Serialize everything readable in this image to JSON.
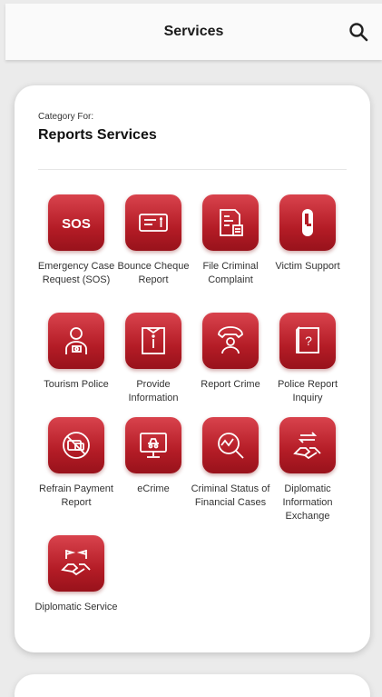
{
  "appbar": {
    "title": "Services",
    "search_icon": "search-icon"
  },
  "card": {
    "category_label": "Category For:",
    "category_title": "Reports Services"
  },
  "services": [
    {
      "label": "Emergency Case Request (SOS)",
      "icon": "sos-icon",
      "icon_text": "SOS"
    },
    {
      "label": "Bounce Cheque Report",
      "icon": "cheque-icon"
    },
    {
      "label": "File Criminal Complaint",
      "icon": "complaint-document-icon"
    },
    {
      "label": "Victim Support",
      "icon": "victim-support-icon"
    },
    {
      "label": "Tourism Police",
      "icon": "tourist-icon"
    },
    {
      "label": "Provide Information",
      "icon": "info-book-icon"
    },
    {
      "label": "Report Crime",
      "icon": "phone-person-icon"
    },
    {
      "label": "Police Report Inquiry",
      "icon": "report-inquiry-icon"
    },
    {
      "label": "Refrain Payment Report",
      "icon": "no-payment-icon"
    },
    {
      "label": "eCrime",
      "icon": "ecrime-monitor-icon"
    },
    {
      "label": "Criminal Status of Financial Cases",
      "icon": "financial-search-icon"
    },
    {
      "label": "Diplomatic Information Exchange",
      "icon": "exchange-handshake-icon"
    },
    {
      "label": "Diplomatic Service",
      "icon": "diplomatic-handshake-icon"
    }
  ],
  "colors": {
    "accent": "#b41c26",
    "accent_light": "#d9434d",
    "card_bg": "#ffffff",
    "page_bg": "#ebebeb"
  }
}
